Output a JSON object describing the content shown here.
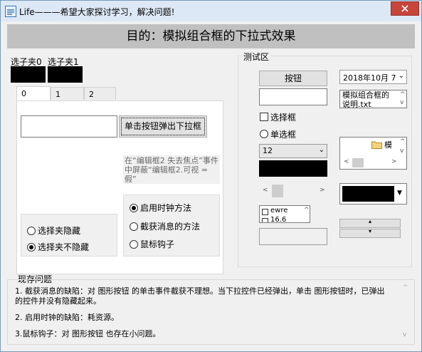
{
  "window": {
    "title": "Life———希望大家探讨学习，解决问题!"
  },
  "header": {
    "title": "目的：模拟组合框的下拉式效果"
  },
  "tab_labels": {
    "label0": "选子夹0",
    "label1": "选子夹1"
  },
  "tabs": [
    {
      "label": "0",
      "selected": true
    },
    {
      "label": "1",
      "selected": false
    },
    {
      "label": "2",
      "selected": false
    }
  ],
  "tab_panel": {
    "edit_value": "",
    "dropdown_button": "单击按钮弹出下拉框",
    "hint": "在“编辑框2 失去焦点”事件中屏蔽“编辑框2.可视 = 假”",
    "hide_options": [
      {
        "label": "选择夹隐藏",
        "checked": false
      },
      {
        "label": "选择夹不隐藏",
        "checked": true
      }
    ],
    "method_options": [
      {
        "label": "启用时钟方法",
        "checked": true
      },
      {
        "label": "截获消息的方法",
        "checked": false
      },
      {
        "label": "鼠标钩子",
        "checked": false
      }
    ]
  },
  "test_area": {
    "title": "测试区",
    "button_label": "按钮",
    "checkbox_label": "选择框",
    "radio_label": "单选框",
    "combo_value": "12",
    "date_value": "2018年10月 7",
    "memo_text": "模拟组合框的说明.txt",
    "tree_item": "模",
    "list_items": [
      "ewre",
      "16.6"
    ]
  },
  "problems": {
    "title": "现存问题",
    "lines": [
      "1. 截获消息的缺陷：对 图形按钮 的单击事件截获不理想。当下拉控件已经弹出，单击 图形按钮时，已弹出的控件并没有隐藏起来。",
      "2. 启用时钟的缺陷：耗资源。",
      "3.鼠标钩子：对 图形按钮 也存在小问题。"
    ]
  }
}
